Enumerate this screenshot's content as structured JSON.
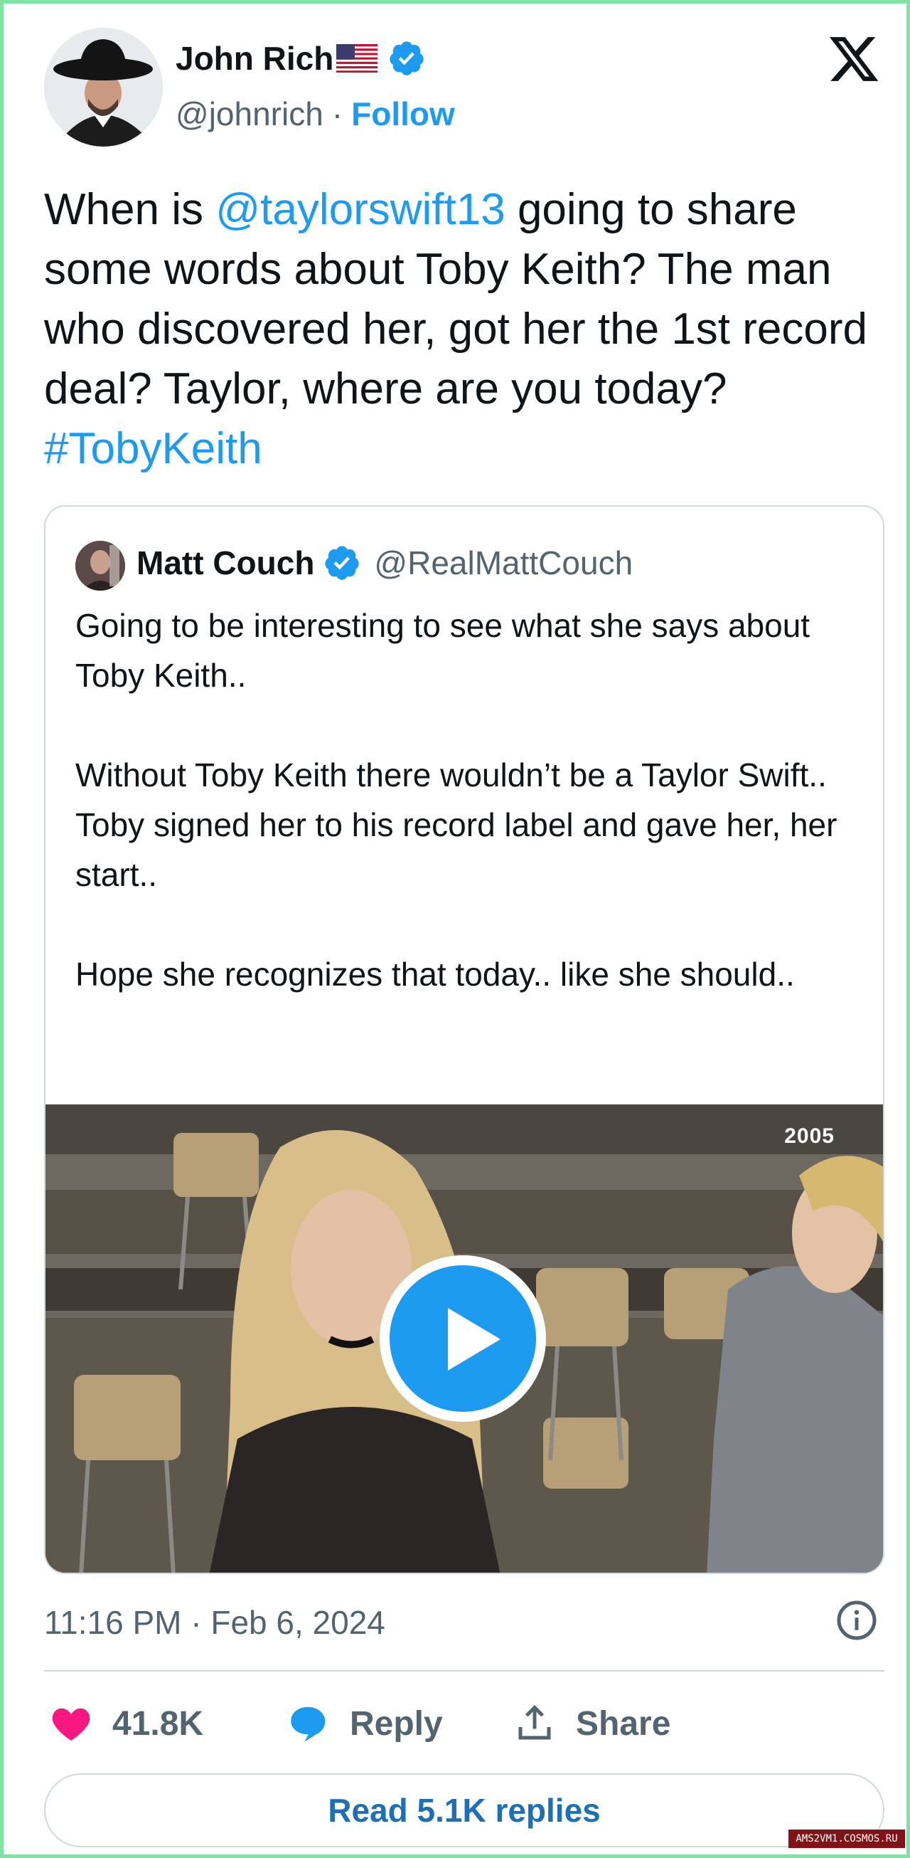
{
  "author": {
    "name": "John Rich",
    "flag": "🇺🇸",
    "handle": "@johnrich",
    "separator": "·",
    "follow_label": "Follow"
  },
  "tweet": {
    "text_prefix": "When is ",
    "mention": "@taylorswift13",
    "text_middle": " going to share some words about Toby Keith? The man who discovered her, got her the 1st record deal? Taylor, where are you today? ",
    "hashtag": "#TobyKeith"
  },
  "quote": {
    "name": "Matt Couch",
    "handle": "@RealMattCouch",
    "paragraphs": [
      "Going to be interesting to see what she says about Toby Keith..",
      "Without Toby Keith there wouldn’t be a Taylor Swift.. Toby signed her to his record label and gave her, her start..",
      "Hope she recognizes that today.. like she should.."
    ],
    "video_year": "2005"
  },
  "timestamp": "11:16 PM · Feb 6, 2024",
  "actions": {
    "like_count": "41.8K",
    "reply_label": "Reply",
    "share_label": "Share"
  },
  "read_replies_label": "Read 5.1K replies",
  "watermark": "AMS2VM1.COSMOS.RU",
  "colors": {
    "accent": "#1d9bf0",
    "like": "#f91880",
    "frame": "#7fe3a6"
  },
  "icons": [
    "x-logo-icon",
    "verified-badge-icon",
    "us-flag-icon",
    "play-icon",
    "info-icon",
    "heart-icon",
    "reply-bubble-icon",
    "share-icon"
  ]
}
